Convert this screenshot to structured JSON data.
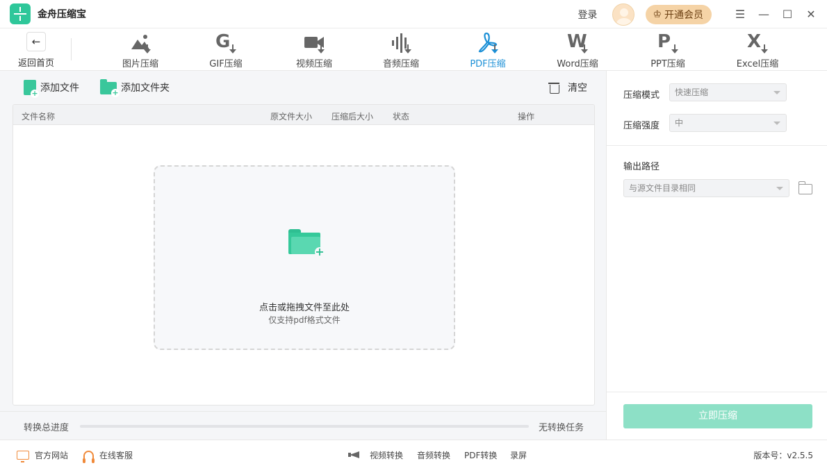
{
  "app": {
    "title": "金舟压缩宝",
    "login": "登录",
    "vip": "开通会员"
  },
  "nav": {
    "back": "返回首页",
    "tabs": [
      {
        "label": "图片压缩",
        "icon": "image-compress-icon"
      },
      {
        "label": "GIF压缩",
        "icon": "gif-compress-icon"
      },
      {
        "label": "视频压缩",
        "icon": "video-compress-icon"
      },
      {
        "label": "音频压缩",
        "icon": "audio-compress-icon"
      },
      {
        "label": "PDF压缩",
        "icon": "pdf-compress-icon",
        "active": true
      },
      {
        "label": "Word压缩",
        "icon": "word-compress-icon"
      },
      {
        "label": "PPT压缩",
        "icon": "ppt-compress-icon"
      },
      {
        "label": "Excel压缩",
        "icon": "excel-compress-icon"
      }
    ]
  },
  "toolbar": {
    "add_file": "添加文件",
    "add_folder": "添加文件夹",
    "clear": "清空"
  },
  "table": {
    "headers": [
      "文件名称",
      "原文件大小",
      "压缩后大小",
      "状态",
      "操作"
    ]
  },
  "dropzone": {
    "main": "点击或拖拽文件至此处",
    "sub": "仅支持pdf格式文件"
  },
  "progress": {
    "label": "转换总进度",
    "value": 0,
    "status": "无转换任务"
  },
  "settings": {
    "mode_label": "压缩模式",
    "mode_value": "快速压缩",
    "strength_label": "压缩强度",
    "strength_value": "中",
    "output_label": "输出路径",
    "output_value": "与源文件目录相同",
    "compress_button": "立即压缩"
  },
  "footer": {
    "website": "官方网站",
    "support": "在线客服",
    "links": [
      "视频转换",
      "音频转换",
      "PDF转换",
      "录屏"
    ],
    "version": "版本号：v2.5.5"
  },
  "colors": {
    "accent": "#39c79b",
    "active_tab": "#1a8fd6",
    "vip_bg": "#f5d3a6",
    "compress_button": "#8de0c6",
    "footer_icon": "#f08a3a"
  }
}
